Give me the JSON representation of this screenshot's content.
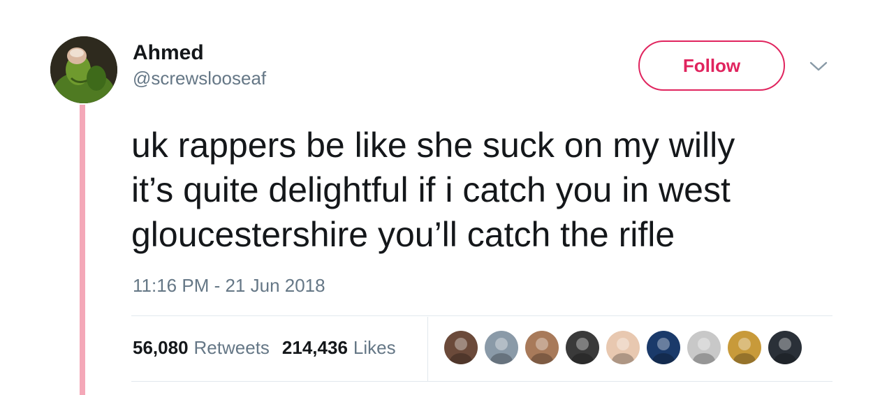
{
  "author": {
    "name": "Ahmed",
    "handle": "@screwslooseaf",
    "avatar_icon": "kermit-frog-avatar"
  },
  "follow_button": {
    "label": "Follow",
    "color": "#e0245e"
  },
  "menu_icon": "chevron-down-icon",
  "tweet": {
    "lines": [
      "uk rappers be like she suck on my willy",
      "it’s quite delightful if i catch you in west",
      "gloucestershire you’ll catch the rifle"
    ],
    "timestamp": "11:16 PM - 21 Jun 2018"
  },
  "stats": {
    "retweets_count": "56,080",
    "retweets_label": "Retweets",
    "likes_count": "214,436",
    "likes_label": "Likes"
  },
  "likers": [
    {
      "name": "liker-avatar-1",
      "color": "#6b4a3a"
    },
    {
      "name": "liker-avatar-2",
      "color": "#8a9aa8"
    },
    {
      "name": "liker-avatar-3",
      "color": "#a87a5a"
    },
    {
      "name": "liker-avatar-4",
      "color": "#3a3a3a"
    },
    {
      "name": "liker-avatar-5",
      "color": "#e8c8b0"
    },
    {
      "name": "liker-avatar-6",
      "color": "#1a3a6a"
    },
    {
      "name": "liker-avatar-7",
      "color": "#c8c8c8"
    },
    {
      "name": "liker-avatar-8",
      "color": "#c89a3a"
    },
    {
      "name": "liker-avatar-9",
      "color": "#2a3038"
    }
  ],
  "colors": {
    "thread_line": "#f4a8b8",
    "text_primary": "#14171a",
    "text_secondary": "#657786",
    "divider": "#e1e8ed"
  }
}
